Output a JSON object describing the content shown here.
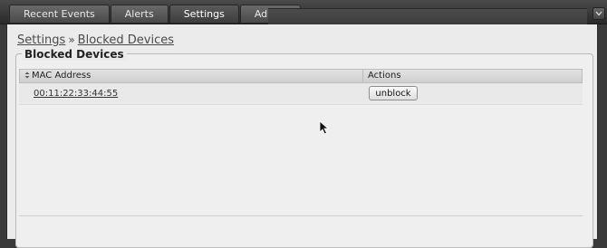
{
  "nav": {
    "tabs": [
      {
        "label": "Recent Events",
        "active": false
      },
      {
        "label": "Alerts",
        "active": false
      },
      {
        "label": "Settings",
        "active": true
      },
      {
        "label": "Admin",
        "active": false
      }
    ],
    "corner_icon": "chevron-down-icon"
  },
  "breadcrumb": {
    "root": "Settings",
    "separator": "»",
    "current": "Blocked Devices"
  },
  "panel": {
    "title": "Blocked Devices",
    "columns": {
      "mac": "MAC Address",
      "sort_icon": "sort-icon",
      "actions": "Actions"
    },
    "rows": [
      {
        "mac": "00:11:22:33:44:55",
        "action": "unblock"
      }
    ]
  },
  "colors": {
    "topbar": "#2f2f2f",
    "page_bg": "#ebebeb",
    "header_bg": "#d8d8d8"
  },
  "cursor_icon": "mouse-pointer-icon"
}
